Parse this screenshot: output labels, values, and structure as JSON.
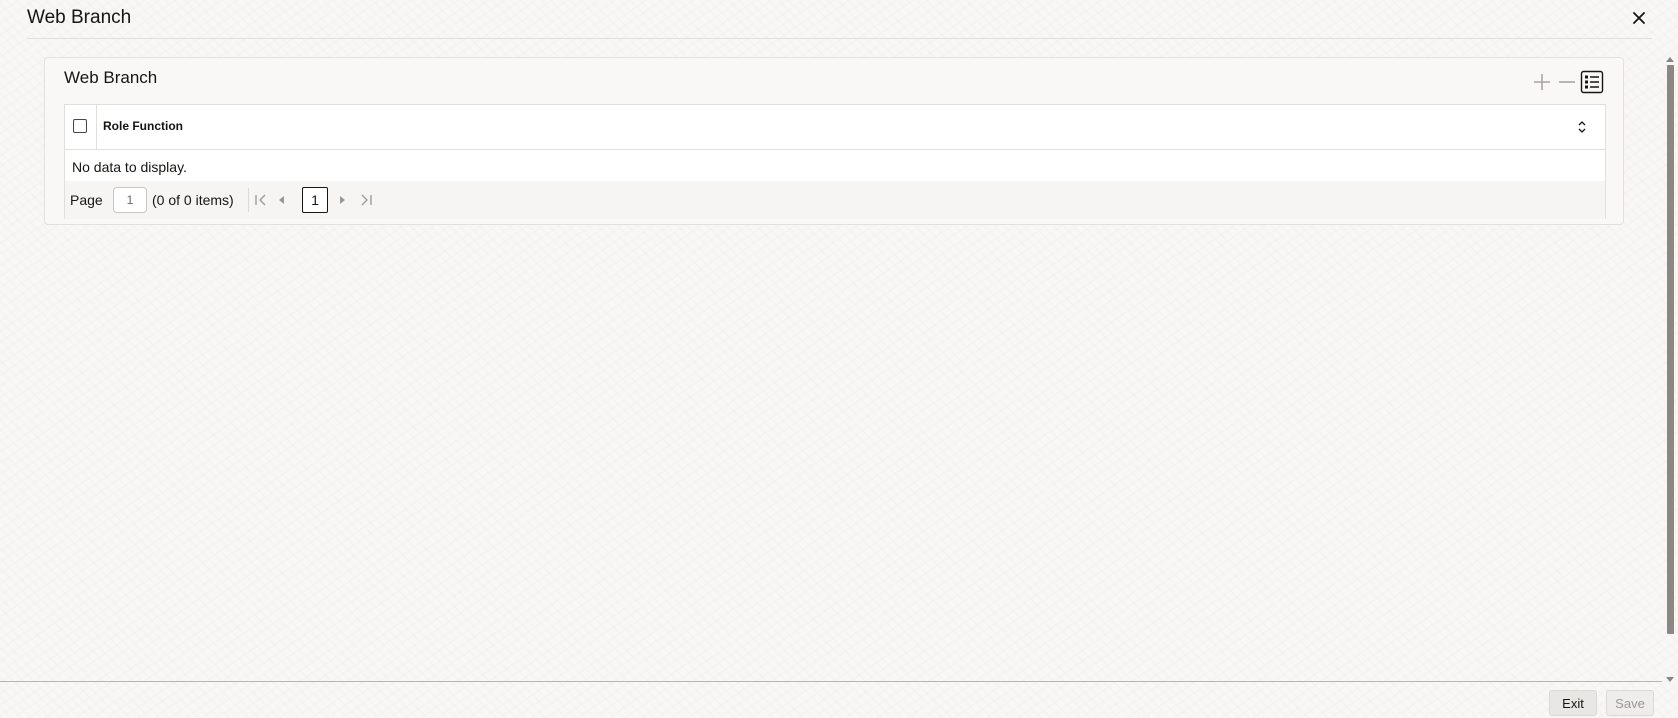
{
  "header": {
    "title": "Web Branch",
    "close_icon": "close-icon"
  },
  "panel": {
    "title": "Web Branch",
    "toolbar": {
      "add_icon": "plus-icon",
      "remove_icon": "minus-icon",
      "details_icon": "list-details-icon"
    }
  },
  "grid": {
    "columns": [
      "Role Function"
    ],
    "rows": [],
    "empty_text": "No data to display.",
    "select_all_checked": false
  },
  "pagination": {
    "page_label": "Page",
    "page_value": "1",
    "items_info": "(0 of 0 items)",
    "current_page": "1"
  },
  "footer": {
    "exit_label": "Exit",
    "save_label": "Save"
  },
  "colors": {
    "text": "#161513",
    "border": "#e2dfdb",
    "disabled_text": "#9b9792"
  }
}
